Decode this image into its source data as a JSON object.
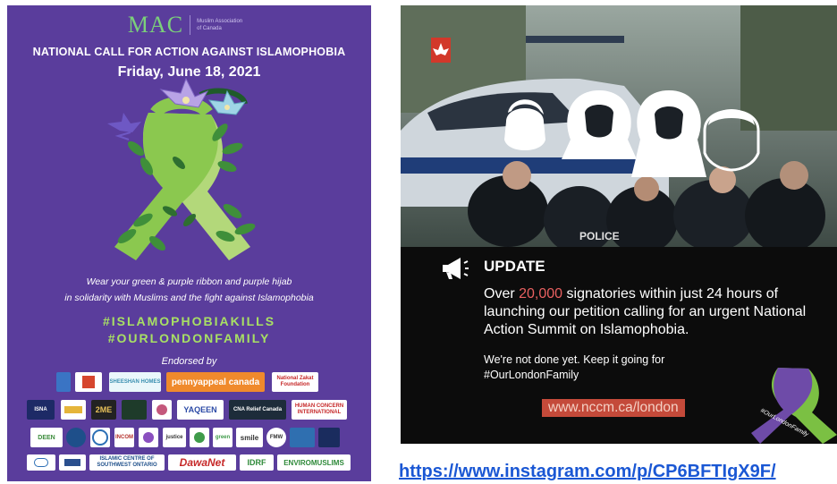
{
  "poster": {
    "org_short": "MAC",
    "org_full": "Muslim Association\nof Canada",
    "title": "NATIONAL CALL FOR ACTION AGAINST ISLAMOPHOBIA",
    "date": "Friday, June 18, 2021",
    "tagline_1": "Wear your green & purple ribbon and purple hijab",
    "tagline_2": "in solidarity with Muslims and the fight against Islamophobia",
    "hashtag_1": "#ISLAMOPHOBIAKILLS",
    "hashtag_2": "#OURLONDONFAMILY",
    "endorsed_by": "Endorsed by",
    "colors": {
      "background": "#5a3d9c",
      "accent_green": "#a8e064",
      "ribbon_green": "#8bc84f"
    },
    "endorser_logos": {
      "row1": [
        "",
        "",
        "SHEESHAN HOMES",
        "pennyappeal canada",
        "National Zakat Foundation"
      ],
      "row2": [
        "ISNA",
        "",
        "2ME",
        "",
        "",
        "YAQEEN",
        "CNA Relief Canada",
        "HUMAN CONCERN INTERNATIONAL"
      ],
      "row3": [
        "DEEN",
        "",
        "",
        "INCOM",
        "",
        "justice",
        "",
        "green",
        "smile",
        "FMW",
        "",
        ""
      ],
      "row4": [
        "",
        "",
        "ISLAMIC CENTRE OF SOUTHWEST ONTARIO",
        "DawaNet",
        "IDRF",
        "ENVIROMUSLIMS"
      ]
    }
  },
  "post": {
    "icon": "megaphone-icon",
    "update_title": "UPDATE",
    "body_prefix": "Over ",
    "highlight_number": "20,000",
    "body_suffix": " signatories within just 24 hours of launching our petition calling for an urgent National Action Summit on Islamophobia.",
    "note": "We're not done yet. Keep it going for #OurLondonFamily",
    "url": "www.nccm.ca/london",
    "ribbon_text": "#OurLondonFamily",
    "photo_text": "POLICE",
    "colors": {
      "highlight": "#e86060",
      "url_bg": "#c44a3a"
    }
  },
  "caption": {
    "link": "https://www.instagram.com/p/CP6BFTIgX9F/"
  }
}
